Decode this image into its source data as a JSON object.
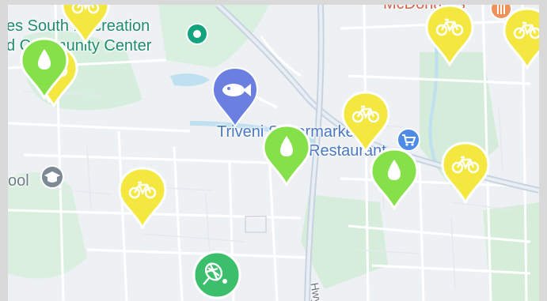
{
  "map": {
    "labels": {
      "rec_center_line1": "es South Recreation",
      "rec_center_line2": "d   Community Center",
      "restaurant_line1": "Triveni Supermarket",
      "restaurant_line2": "Restaurant",
      "school": "ool",
      "mcdonalds": "McDonald's",
      "road": "Hwy"
    },
    "colors": {
      "bike_pin": "#f4e840",
      "water_pin": "#86e04a",
      "sports_pin": "#3bbf6c",
      "park_poi": "#13a37f",
      "restaurant_poi": "#6b7fe0",
      "store_poi": "#4d8be6"
    },
    "pins": [
      {
        "type": "bike",
        "icon": "bicycle-icon"
      },
      {
        "type": "bike",
        "icon": "bicycle-icon"
      },
      {
        "type": "bike",
        "icon": "bicycle-icon"
      },
      {
        "type": "bike",
        "icon": "bicycle-icon"
      },
      {
        "type": "bike",
        "icon": "bicycle-icon"
      },
      {
        "type": "bike",
        "icon": "bicycle-icon"
      },
      {
        "type": "bike",
        "icon": "bicycle-icon"
      },
      {
        "type": "bike",
        "icon": "bicycle-icon"
      },
      {
        "type": "water",
        "icon": "water-drop-icon"
      },
      {
        "type": "water",
        "icon": "water-drop-icon"
      },
      {
        "type": "water",
        "icon": "water-drop-icon"
      },
      {
        "type": "sports",
        "icon": "tennis-icon"
      }
    ],
    "pois": [
      {
        "type": "park",
        "icon": "park-icon"
      },
      {
        "type": "restaurant",
        "icon": "fish-icon"
      },
      {
        "type": "store",
        "icon": "shopping-cart-icon"
      },
      {
        "type": "school",
        "icon": "graduation-cap-icon"
      },
      {
        "type": "food",
        "icon": "fork-knife-icon"
      }
    ]
  }
}
